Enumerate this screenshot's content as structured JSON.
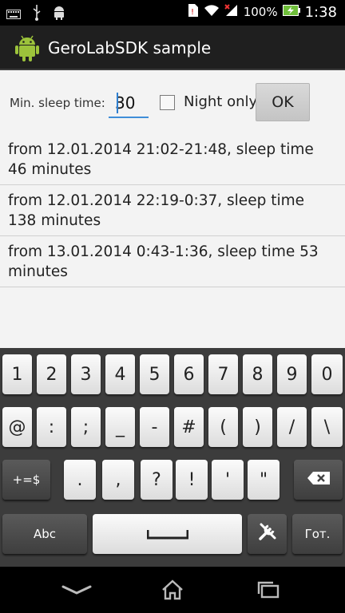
{
  "status_bar": {
    "battery_percent": "100%",
    "time": "1:38",
    "icons_left": [
      "keyboard-icon",
      "usb-icon",
      "android-debug-icon"
    ],
    "icons_right": [
      "sim-warning-icon",
      "wifi-icon",
      "signal-icon",
      "battery-charging-icon"
    ]
  },
  "action_bar": {
    "title": "GeroLabSDK sample",
    "icon": "android-logo-icon"
  },
  "form": {
    "min_sleep_label": "Min. sleep time:",
    "min_sleep_value": "30",
    "night_only_label": "Night only",
    "night_only_checked": false,
    "ok_label": "OK"
  },
  "sleep_list": [
    {
      "text": "from 12.01.2014 21:02-21:48, sleep time 46 minutes"
    },
    {
      "text": "from 12.01.2014 22:19-0:37, sleep time 138 minutes"
    },
    {
      "text": "from 13.01.2014 0:43-1:36, sleep time 53 minutes"
    }
  ],
  "keyboard": {
    "row1": [
      "1",
      "2",
      "3",
      "4",
      "5",
      "6",
      "7",
      "8",
      "9",
      "0"
    ],
    "row2": [
      "@",
      ":",
      ";",
      "_",
      "-",
      "#",
      "(",
      ")",
      "/",
      "\\"
    ],
    "row3": [
      ".",
      ",",
      "?",
      "!",
      "'",
      "\""
    ],
    "shift_label": "+=$",
    "abc_label": "Abc",
    "done_label": "Гот.",
    "icons": [
      "backspace-icon",
      "space-icon",
      "settings-tools-icon"
    ]
  },
  "nav_bar": {
    "icons": [
      "back-icon",
      "home-icon",
      "recent-apps-icon"
    ]
  },
  "colors": {
    "accent": "#3f8ed8",
    "action_bar": "#1f1f1f",
    "keyboard_bg": "#3c3c3c"
  }
}
